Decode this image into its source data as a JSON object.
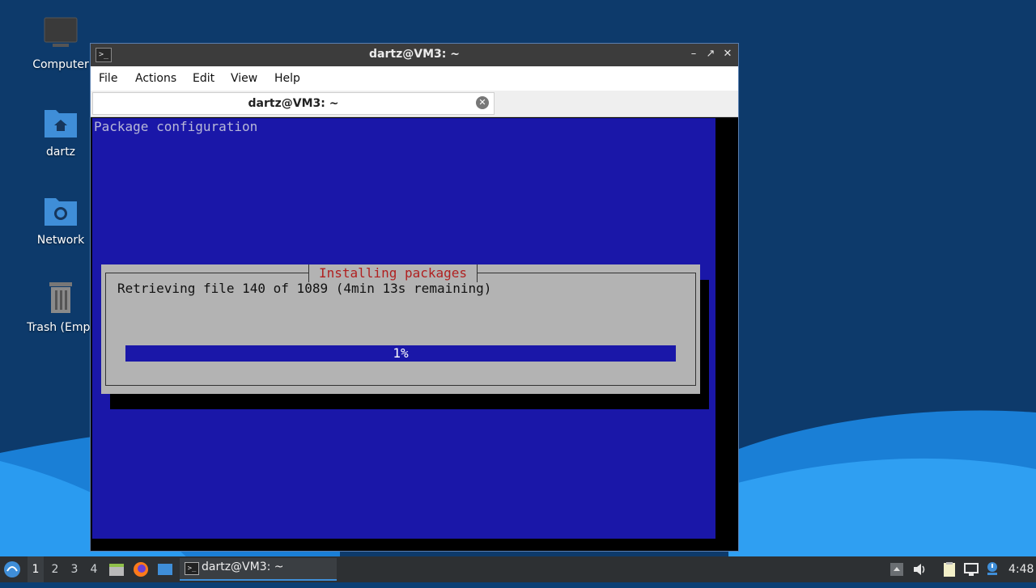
{
  "desktop": {
    "icons": [
      {
        "label": "Computer"
      },
      {
        "label": "dartz"
      },
      {
        "label": "Network"
      },
      {
        "label": "Trash (Empt"
      }
    ]
  },
  "window": {
    "title": "dartz@VM3: ~",
    "menu": [
      "File",
      "Actions",
      "Edit",
      "View",
      "Help"
    ],
    "tab_label": "dartz@VM3: ~"
  },
  "terminal": {
    "header": "Package configuration",
    "dialog": {
      "title": "Installing packages",
      "message": "Retrieving file 140 of 1089 (4min 13s remaining)",
      "progress_label": "1%",
      "progress_fraction": 1.0
    }
  },
  "taskbar": {
    "workspaces": [
      "1",
      "2",
      "3",
      "4"
    ],
    "active_workspace": "1",
    "task_label": "dartz@VM3: ~",
    "clock": "4:48"
  },
  "colors": {
    "terminal_bg": "#1a17a8",
    "dialog_bg": "#b3b3b3",
    "dialog_title": "#b02020"
  }
}
